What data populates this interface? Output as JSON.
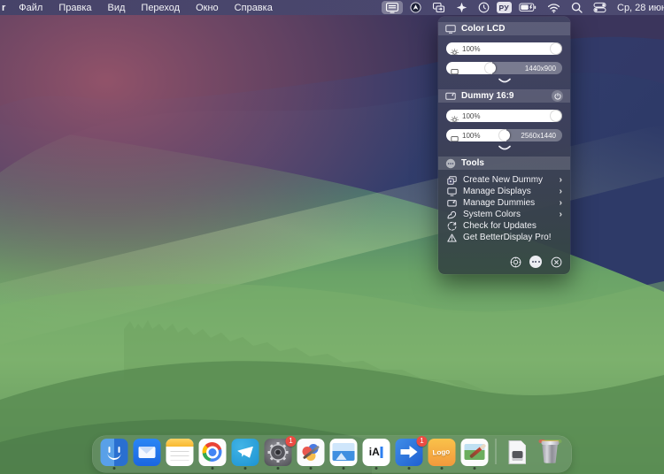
{
  "glyphs": {
    "chevron_right": "›"
  },
  "menu_bar": {
    "app_fragment": "r",
    "items": [
      "Файл",
      "Правка",
      "Вид",
      "Переход",
      "Окно",
      "Справка"
    ],
    "language": "РУ",
    "clock": "Ср, 28 июн.",
    "status_icons": [
      "better-display",
      "circle-arrow",
      "windows-switch",
      "spray-star",
      "timer-circle",
      "input-source",
      "battery",
      "wifi",
      "search",
      "control-center"
    ]
  },
  "panel": {
    "display1": {
      "title": "Color LCD",
      "brightness": "100%",
      "resolution": "1440x900"
    },
    "display2": {
      "title": "Dummy 16:9",
      "brightness": "100%",
      "scale": "100%",
      "resolution": "2560x1440"
    },
    "tools": {
      "title": "Tools",
      "items": [
        {
          "label": "Create New Dummy",
          "has_submenu": true
        },
        {
          "label": "Manage Displays",
          "has_submenu": true
        },
        {
          "label": "Manage Dummies",
          "has_submenu": true
        },
        {
          "label": "System Colors",
          "has_submenu": true
        },
        {
          "label": "Check for Updates",
          "has_submenu": false
        },
        {
          "label": "Get BetterDisplay Pro!",
          "has_submenu": false
        }
      ]
    }
  },
  "dock": {
    "apps": [
      {
        "name": "finder",
        "running": true
      },
      {
        "name": "mail",
        "running": false
      },
      {
        "name": "notes",
        "running": false
      },
      {
        "name": "chrome",
        "running": true
      },
      {
        "name": "telegram",
        "running": true
      },
      {
        "name": "system-settings",
        "running": true,
        "badge": "1"
      },
      {
        "name": "paint-app",
        "running": true
      },
      {
        "name": "photo-viewer",
        "running": true
      },
      {
        "name": "ia-writer",
        "running": true,
        "label": "iA"
      },
      {
        "name": "share-arrow-app",
        "running": true,
        "badge": "1"
      },
      {
        "name": "logo-app",
        "running": true,
        "label": "Logo"
      },
      {
        "name": "image-editor",
        "running": true
      },
      {
        "name": "document-file",
        "running": false
      },
      {
        "name": "trash",
        "running": false
      }
    ]
  },
  "colors": {
    "menubar_bg": "#4b4972",
    "panel_bg": "#3e4160",
    "badge_red": "#ec4b42",
    "accent_white": "#ffffff"
  }
}
